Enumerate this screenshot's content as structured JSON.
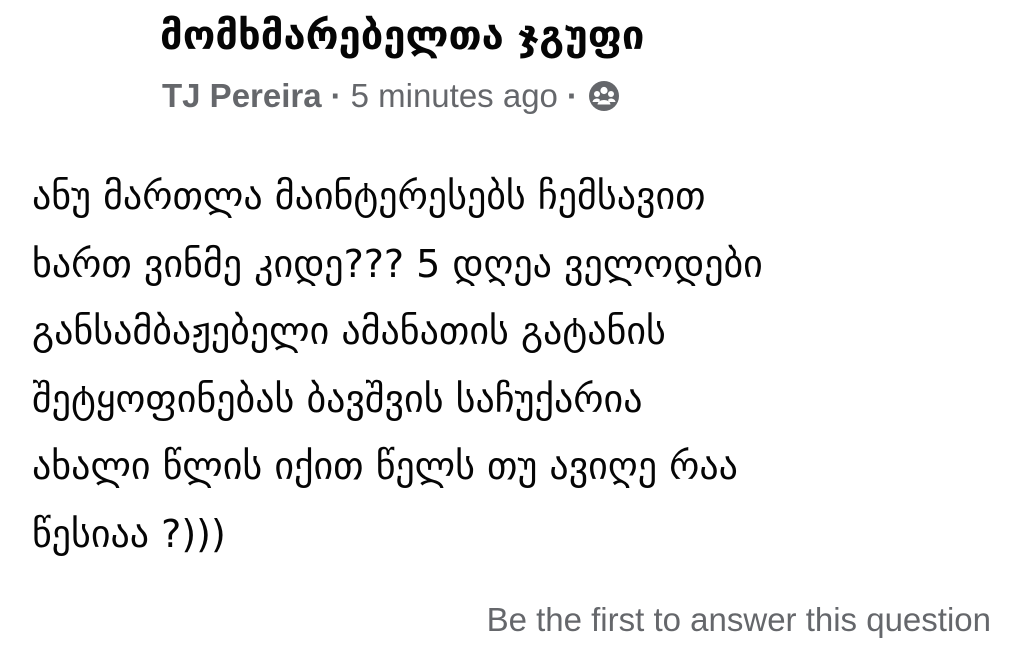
{
  "post": {
    "group_name": "მომხმარებელთა ჯგუფი",
    "author": "TJ Pereira",
    "separator": "·",
    "time": "5 minutes ago",
    "privacy_icon": "group-members-icon",
    "body_lines": [
      "ანუ მართლა მაინტერესებს ჩემსავით",
      "ხართ ვინმე კიდე??? 5 დღეა ველოდები",
      "განსამბაჟებელი ამანათის გატანის",
      "შეტყოფინებას ბავშვის საჩუქარია",
      "ახალი წლის იქით წელს თუ ავიღე რაა",
      "წესიაა ?)))"
    ],
    "answer_prompt": "Be the first to answer this question"
  },
  "colors": {
    "primary_text": "#050505",
    "secondary_text": "#65676b",
    "background": "#ffffff"
  }
}
